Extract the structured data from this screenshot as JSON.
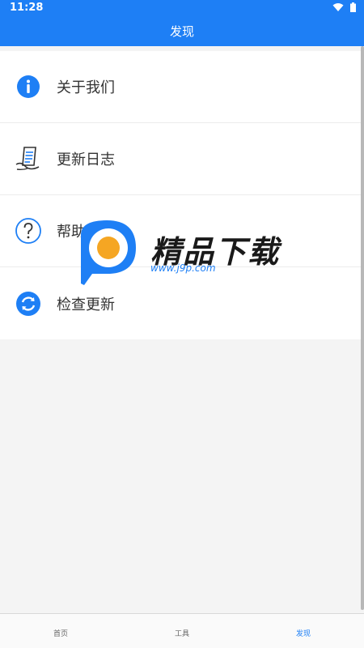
{
  "status_bar": {
    "time": "11:28"
  },
  "app_bar": {
    "title": "发现"
  },
  "menu": [
    {
      "label": "关于我们",
      "icon": "info-icon"
    },
    {
      "label": "更新日志",
      "icon": "changelog-icon"
    },
    {
      "label": "帮助中心",
      "icon": "help-icon"
    },
    {
      "label": "检查更新",
      "icon": "refresh-icon"
    }
  ],
  "watermark": {
    "brand": "精品下载",
    "url": "www.j9p.com"
  },
  "tabs": [
    {
      "label": "首页",
      "active": false
    },
    {
      "label": "工具",
      "active": false
    },
    {
      "label": "发现",
      "active": true
    }
  ],
  "colors": {
    "primary": "#1e7ff5",
    "background": "#f4f4f4",
    "card": "#ffffff"
  }
}
